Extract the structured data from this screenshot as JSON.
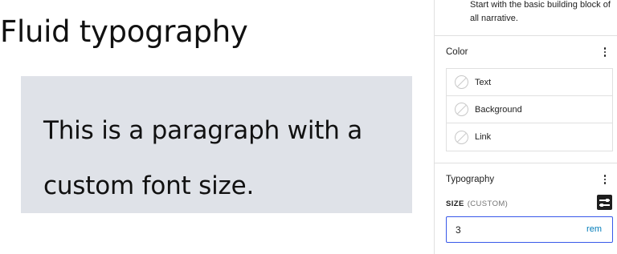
{
  "canvas": {
    "heading": "Fluid typography",
    "paragraph": "This is a paragraph with a custom font size."
  },
  "sidebar": {
    "block_description": "Start with the basic building block of all narrative.",
    "color": {
      "title": "Color",
      "items": [
        {
          "label": "Text",
          "icon": "swatch-empty-icon"
        },
        {
          "label": "Background",
          "icon": "swatch-empty-icon"
        },
        {
          "label": "Link",
          "icon": "swatch-empty-icon"
        }
      ]
    },
    "typography": {
      "title": "Typography",
      "size_label": "SIZE",
      "size_mode": "(CUSTOM)",
      "size_value": "3",
      "unit": "rem"
    },
    "colors": {
      "accent": "#3858e9",
      "unit_link": "#007cba",
      "paragraph_background": "#dfe2e8"
    }
  }
}
